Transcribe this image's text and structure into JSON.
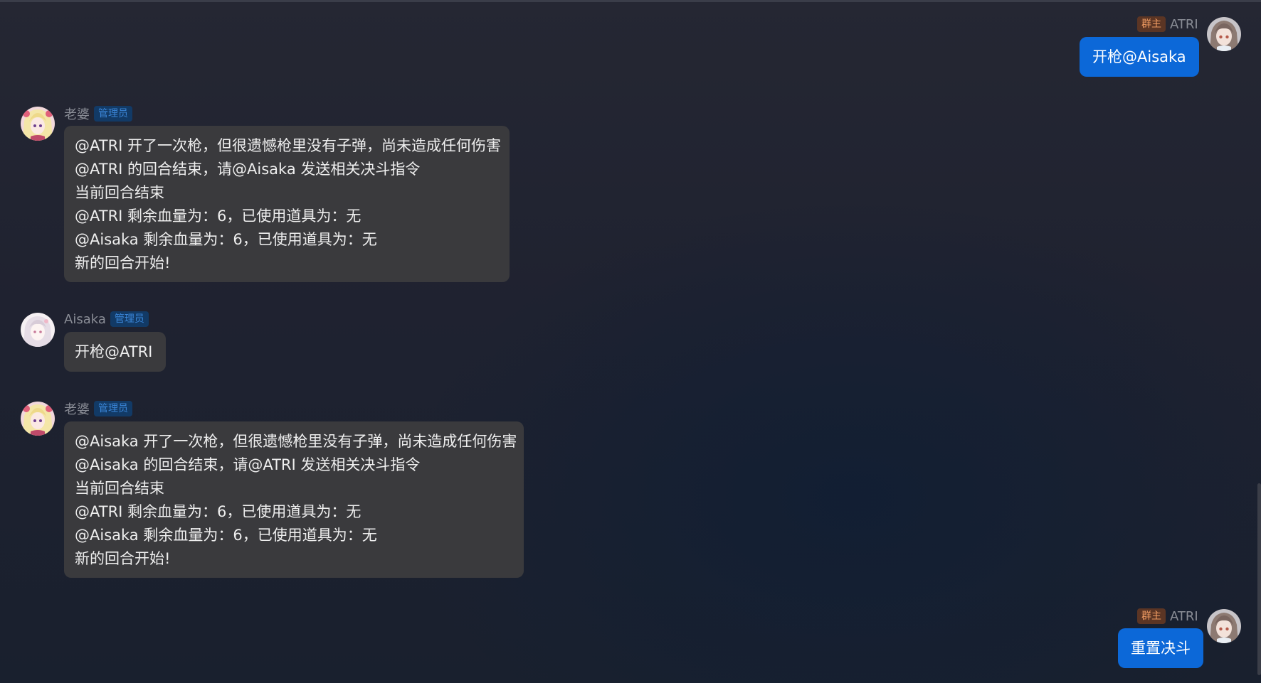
{
  "badges": {
    "owner": "群主",
    "admin": "管理员"
  },
  "messages": [
    {
      "id": "m1",
      "side": "right",
      "sender": "ATRI",
      "badge": "群主",
      "text": "开枪@Aisaka"
    },
    {
      "id": "m2",
      "side": "left",
      "sender": "老婆",
      "badge": "管理员",
      "lines": [
        "@ATRI 开了一次枪，但很遗憾枪里没有子弹，尚未造成任何伤害",
        "@ATRI 的回合结束，请@Aisaka 发送相关决斗指令",
        "当前回合结束",
        "@ATRI 剩余血量为：6，已使用道具为：无",
        "@Aisaka 剩余血量为：6，已使用道具为：无",
        "新的回合开始!"
      ]
    },
    {
      "id": "m3",
      "side": "left",
      "sender": "Aisaka",
      "badge": "管理员",
      "text": "开枪@ATRI"
    },
    {
      "id": "m4",
      "side": "left",
      "sender": "老婆",
      "badge": "管理员",
      "lines": [
        "@Aisaka 开了一次枪，但很遗憾枪里没有子弹，尚未造成任何伤害",
        "@Aisaka 的回合结束，请@ATRI 发送相关决斗指令",
        "当前回合结束",
        "@ATRI 剩余血量为：6，已使用道具为：无",
        "@Aisaka 剩余血量为：6，已使用道具为：无",
        "新的回合开始!"
      ]
    },
    {
      "id": "m5",
      "side": "right",
      "sender": "ATRI",
      "badge": "群主",
      "text": "重置决斗"
    }
  ],
  "colors": {
    "bubble_self": "#0c68d8",
    "bubble_other": "#3a3a3d",
    "badge_owner_bg": "#5b3524",
    "badge_admin_bg": "#123a66"
  }
}
